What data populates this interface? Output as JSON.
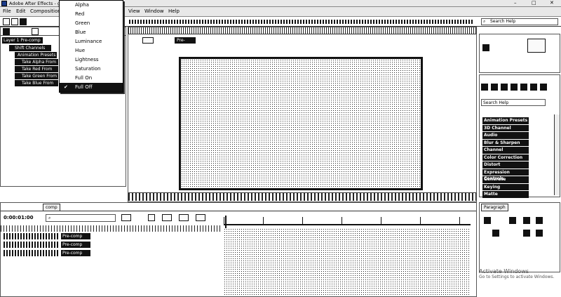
{
  "app": {
    "title": "Adobe After Effects - gif"
  },
  "menubar": {
    "file": "File",
    "edit": "Edit",
    "composition": "Composition",
    "view": "View",
    "window": "Window",
    "help": "Help"
  },
  "project": {
    "search_label": "Search Help",
    "layer_name": "Layer 1 Pre-comp",
    "shift_channels": "Shift Channels",
    "animation_presets": "Animation Presets",
    "properties": [
      "Take Alpha From",
      "Take Red From",
      "Take Green From",
      "Take Blue From"
    ]
  },
  "dropdown": {
    "items": [
      "Alpha",
      "Red",
      "Green",
      "Blue",
      "Luminance",
      "Hue",
      "Lightness",
      "Saturation",
      "Full On",
      "Full Off"
    ],
    "checked_index": 9
  },
  "composition": {
    "tab_label": "Pre-comp"
  },
  "effects": {
    "search": "Search Help",
    "list": [
      "Animation Presets",
      "3D Channel",
      "Audio",
      "Blur & Sharpen",
      "Channel",
      "Color Correction",
      "Distort",
      "Expression Controls",
      "Generate",
      "Keying",
      "Matte"
    ]
  },
  "timeline": {
    "tab_label": "comp",
    "timecode": "0:00:01:00",
    "layers": [
      {
        "name": "Pre-comp"
      },
      {
        "name": "Pre-comp"
      },
      {
        "name": "Pre-comp"
      }
    ]
  },
  "align": {
    "title": "Paragraph"
  },
  "watermark": {
    "line1": "Activate Windows",
    "line2": "Go to Settings to activate Windows."
  },
  "colors": {
    "accent": "#111111",
    "selection": "#000000",
    "panel_bg": "#ffffff"
  }
}
